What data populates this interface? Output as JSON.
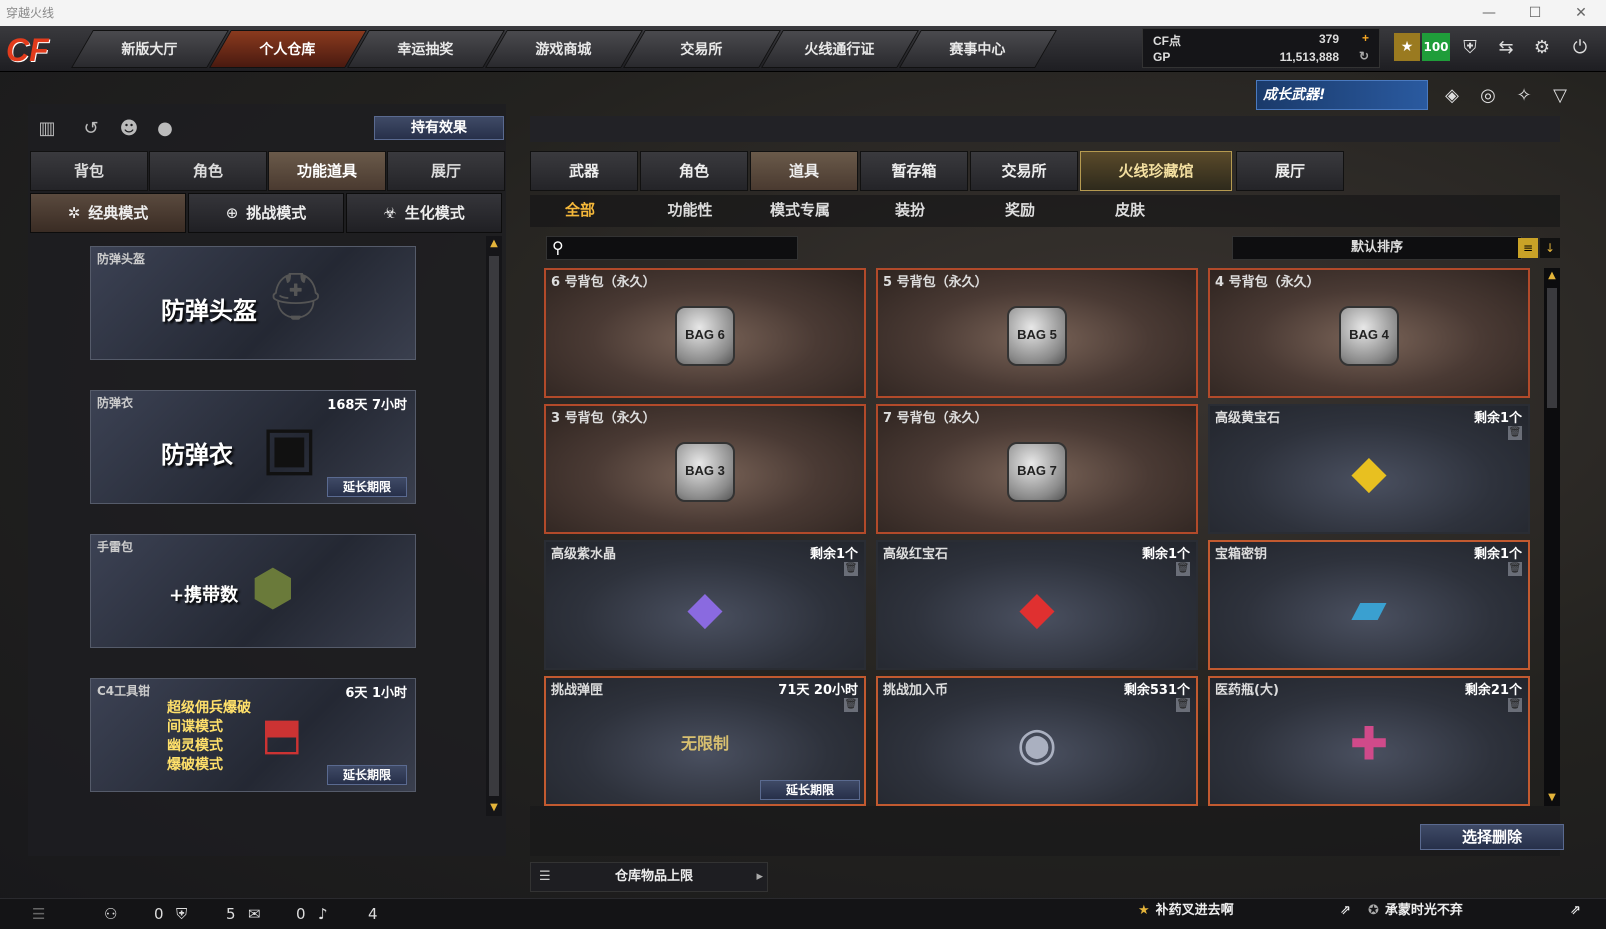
{
  "window": {
    "title": "穿越火线",
    "min": "—",
    "max": "☐",
    "close": "✕"
  },
  "logo": "CF",
  "nav": [
    "新版大厅",
    "个人仓库",
    "幸运抽奖",
    "游戏商城",
    "交易所",
    "火线通行证",
    "赛事中心"
  ],
  "account": {
    "cf_label": "CF点",
    "cf_value": "379",
    "gp_label": "GP",
    "gp_value": "11,513,888",
    "level": "100"
  },
  "banner": "成长武器!",
  "left": {
    "effects_button": "持有效果",
    "tabs": [
      "背包",
      "角色",
      "功能道具",
      "展厅"
    ],
    "modes": [
      "经典模式",
      "挑战模式",
      "生化模式"
    ],
    "features": [
      {
        "title": "防弹头盔",
        "big": "防弹头盔",
        "duration": "",
        "extend": ""
      },
      {
        "title": "防弹衣",
        "big": "防弹衣",
        "duration": "168天 7小时",
        "extend": "延长期限"
      },
      {
        "title": "手雷包",
        "big": "+携带数",
        "duration": "",
        "extend": ""
      },
      {
        "title": "C4工具钳",
        "big": "超级佣兵爆破\n间谍模式\n幽灵模式\n爆破模式",
        "duration": "6天 1小时",
        "extend": "延长期限"
      }
    ]
  },
  "right": {
    "tabs": [
      "武器",
      "角色",
      "道具",
      "暂存箱",
      "交易所",
      "火线珍藏馆",
      "展厅"
    ],
    "subtabs": [
      "全部",
      "功能性",
      "模式专属",
      "装扮",
      "奖励",
      "皮肤"
    ],
    "search_placeholder": "",
    "sort": "默认排序",
    "items": [
      {
        "name": "6 号背包（永久）",
        "count": "",
        "icon": "BAG 6",
        "extend": ""
      },
      {
        "name": "5 号背包（永久）",
        "count": "",
        "icon": "BAG 5",
        "extend": ""
      },
      {
        "name": "4 号背包（永久）",
        "count": "",
        "icon": "BAG 4",
        "extend": ""
      },
      {
        "name": "3 号背包（永久）",
        "count": "",
        "icon": "BAG 3",
        "extend": ""
      },
      {
        "name": "7 号背包（永久）",
        "count": "",
        "icon": "BAG 7",
        "extend": ""
      },
      {
        "name": "高级黄宝石",
        "count": "剩余1个",
        "icon": "◆",
        "extend": ""
      },
      {
        "name": "高级紫水晶",
        "count": "剩余1个",
        "icon": "◆",
        "extend": ""
      },
      {
        "name": "高级红宝石",
        "count": "剩余1个",
        "icon": "◆",
        "extend": ""
      },
      {
        "name": "宝箱密钥",
        "count": "剩余1个",
        "icon": "▰",
        "extend": ""
      },
      {
        "name": "挑战弹匣",
        "count": "71天 20小时",
        "icon": "无限制",
        "extend": "延长期限"
      },
      {
        "name": "挑战加入币",
        "count": "剩余531个",
        "icon": "◉",
        "extend": ""
      },
      {
        "name": "医药瓶(大)",
        "count": "剩余21个",
        "icon": "✚",
        "extend": ""
      }
    ],
    "delete_button": "选择删除",
    "limit_label": "仓库物品上限"
  },
  "status": {
    "c1": "0",
    "c2": "5",
    "c3": "0",
    "c4": "4",
    "friend1": "补药叉进去啊",
    "friend2": "承蒙时光不弃"
  },
  "colors": {
    "accent": "#b24a2a",
    "gold": "#e4b43a",
    "level_green": "#1f9d3a"
  }
}
